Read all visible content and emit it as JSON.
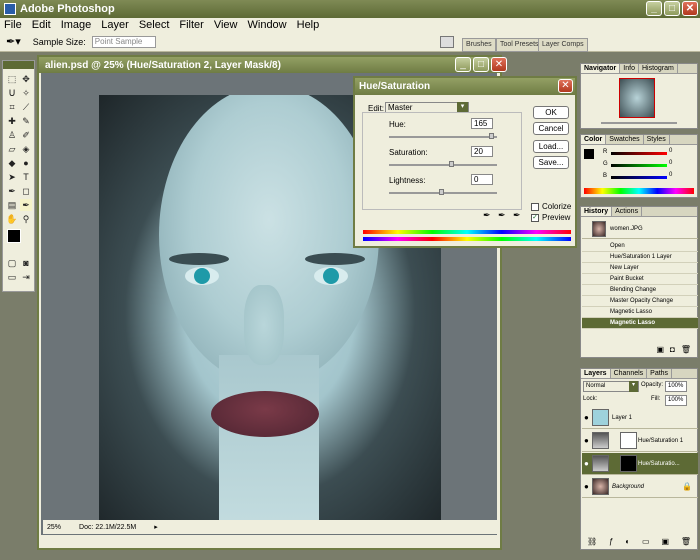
{
  "app": {
    "title": "Adobe Photoshop"
  },
  "menu": [
    "File",
    "Edit",
    "Image",
    "Layer",
    "Select",
    "Filter",
    "View",
    "Window",
    "Help"
  ],
  "options": {
    "sample_size_label": "Sample Size:",
    "sample_size_value": "Point Sample"
  },
  "palette_well": [
    "Brushes",
    "Tool Presets",
    "Layer Comps"
  ],
  "document": {
    "title": "alien.psd @ 25% (Hue/Saturation 2, Layer Mask/8)",
    "zoom": "25%",
    "doc_size": "Doc: 22.1M/22.5M"
  },
  "dialog": {
    "title": "Hue/Saturation",
    "edit_label": "Edit:",
    "edit_value": "Master",
    "hue_label": "Hue:",
    "hue_value": "165",
    "saturation_label": "Saturation:",
    "saturation_value": "20",
    "lightness_label": "Lightness:",
    "lightness_value": "0",
    "ok": "OK",
    "cancel": "Cancel",
    "load": "Load...",
    "save": "Save...",
    "colorize": "Colorize",
    "preview": "Preview",
    "colorize_checked": false,
    "preview_checked": true
  },
  "navigator": {
    "tabs": [
      "Navigator",
      "Info",
      "Histogram"
    ]
  },
  "color_panel": {
    "tabs": [
      "Color",
      "Swatches",
      "Styles"
    ],
    "channels": [
      "R",
      "G",
      "B"
    ],
    "values": [
      "0",
      "0",
      "0"
    ]
  },
  "history": {
    "tabs": [
      "History",
      "Actions"
    ],
    "snapshot": "women.JPG",
    "items": [
      "Open",
      "Hue/Saturation 1 Layer",
      "New Layer",
      "Paint Bucket",
      "Blending Change",
      "Master Opacity Change",
      "Magnetic Lasso",
      "Magnetic Lasso"
    ]
  },
  "layers": {
    "tabs": [
      "Layers",
      "Channels",
      "Paths"
    ],
    "blend_mode": "Normal",
    "opacity_label": "Opacity:",
    "opacity": "100%",
    "fill_label": "Fill:",
    "fill": "100%",
    "lock_label": "Lock:",
    "items": [
      "Layer 1",
      "Hue/Saturation 1",
      "Hue/Saturatio...",
      "Background"
    ]
  }
}
